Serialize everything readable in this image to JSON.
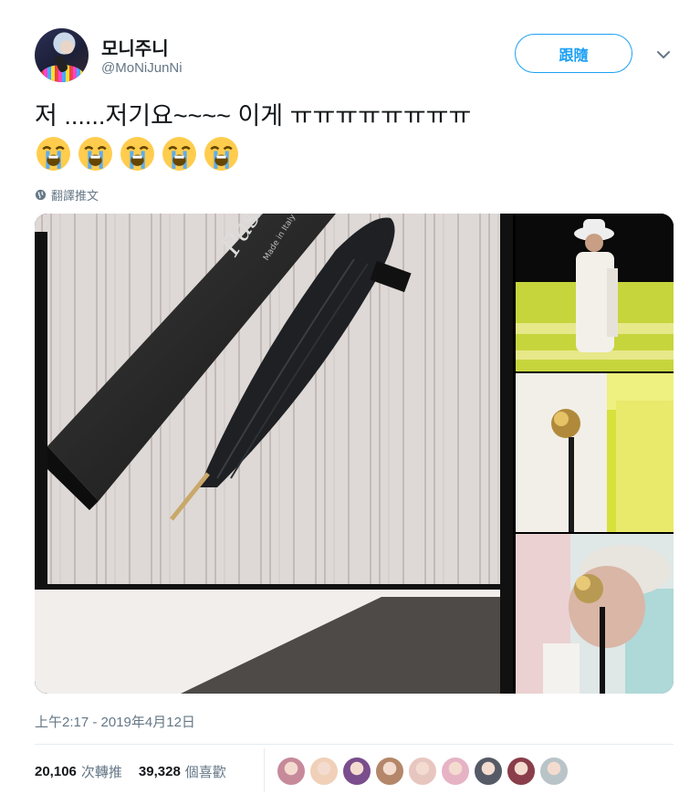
{
  "tweet": {
    "display_name": "모니주니",
    "handle": "@MoNiJunNi",
    "follow_label": "跟隨",
    "text": "저 ......저기요~~~~ 이게 ㅠㅠㅠㅠㅠㅠㅠㅠ",
    "emoji_count": 5,
    "translate_label": "翻譯推文",
    "timestamp": "上午2:17 - 2019年4月12日",
    "retweets_count": "20,106",
    "retweets_label": "次轉推",
    "likes_count": "39,328",
    "likes_label": "個喜歡"
  },
  "media": {
    "box_brand": "Pasotti",
    "box_subtext": "Made in Italy"
  },
  "likers": [
    {
      "name": "liker-avatar-1",
      "color": "#c78a9a"
    },
    {
      "name": "liker-avatar-2",
      "color": "#f0d0b8"
    },
    {
      "name": "liker-avatar-3",
      "color": "#7a4d8c"
    },
    {
      "name": "liker-avatar-4",
      "color": "#b4876a"
    },
    {
      "name": "liker-avatar-5",
      "color": "#e8c6c0"
    },
    {
      "name": "liker-avatar-6",
      "color": "#e6b3c5"
    },
    {
      "name": "liker-avatar-7",
      "color": "#555a66"
    },
    {
      "name": "liker-avatar-8",
      "color": "#8a3d4a"
    },
    {
      "name": "liker-avatar-9",
      "color": "#b9c4c9"
    }
  ]
}
